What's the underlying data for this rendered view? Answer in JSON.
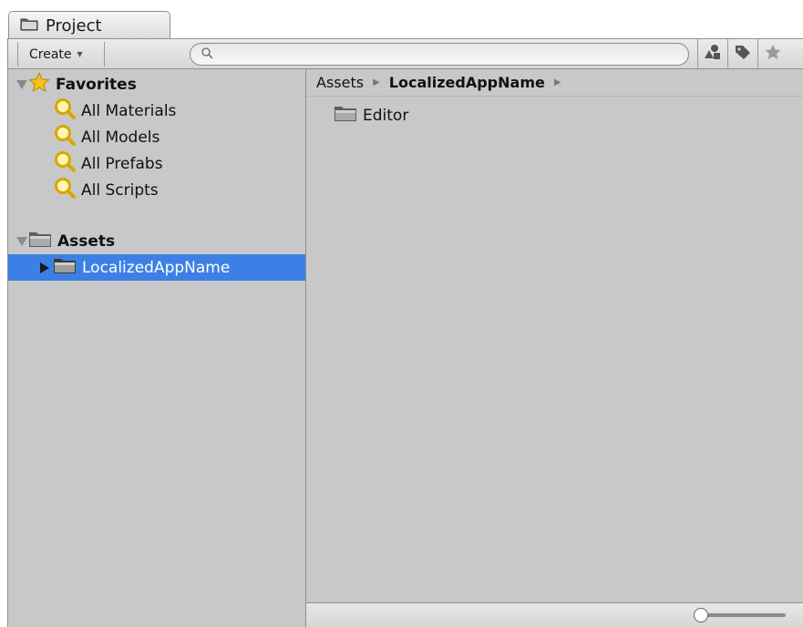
{
  "window": {
    "tab_label": "Project"
  },
  "toolbar": {
    "create_label": "Create",
    "search_value": "",
    "search_placeholder": "",
    "buttons": [
      "search-by-type-icon",
      "search-by-label-icon",
      "favorite-star-icon"
    ]
  },
  "sidebar": {
    "favorites": {
      "label": "Favorites",
      "items": [
        {
          "label": "All Materials"
        },
        {
          "label": "All Models"
        },
        {
          "label": "All Prefabs"
        },
        {
          "label": "All Scripts"
        }
      ]
    },
    "assets": {
      "label": "Assets",
      "items": [
        {
          "label": "LocalizedAppName",
          "selected": true
        }
      ]
    }
  },
  "main": {
    "breadcrumb": [
      "Assets",
      "LocalizedAppName"
    ],
    "items": [
      {
        "label": "Editor",
        "icon": "folder-icon"
      }
    ]
  },
  "colors": {
    "selection": "#3d80e5",
    "panel_bg": "#c8c8c8"
  }
}
